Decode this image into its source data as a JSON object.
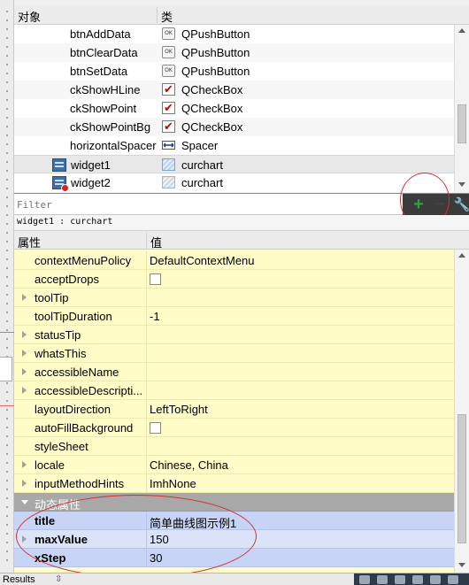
{
  "object_inspector": {
    "col_object": "对象",
    "col_class": "类",
    "rows": [
      {
        "name": "btnAddData",
        "class": "QPushButton",
        "icon": "pushbutton-icon",
        "glyph": "OK"
      },
      {
        "name": "btnClearData",
        "class": "QPushButton",
        "icon": "pushbutton-icon",
        "glyph": "OK"
      },
      {
        "name": "btnSetData",
        "class": "QPushButton",
        "icon": "pushbutton-icon",
        "glyph": "OK"
      },
      {
        "name": "ckShowHLine",
        "class": "QCheckBox",
        "icon": "checkbox-icon",
        "glyph": "✔"
      },
      {
        "name": "ckShowPoint",
        "class": "QCheckBox",
        "icon": "checkbox-icon",
        "glyph": "✔"
      },
      {
        "name": "ckShowPointBg",
        "class": "QCheckBox",
        "icon": "checkbox-icon",
        "glyph": "✔"
      },
      {
        "name": "horizontalSpacer",
        "class": "Spacer",
        "icon": "spacer-icon",
        "glyph": "⟷"
      },
      {
        "name": "widget1",
        "class": "curchart",
        "icon": "curchart-icon",
        "glyph": ""
      },
      {
        "name": "widget2",
        "class": "curchart",
        "icon": "curchart-icon",
        "glyph": ""
      }
    ]
  },
  "filter": {
    "placeholder": "Filter",
    "add_label": "+",
    "remove_label": "−",
    "configure_label": "🔧"
  },
  "selected_caption": "widget1 : curchart",
  "property_editor": {
    "col_property": "属性",
    "col_value": "值",
    "rows": [
      {
        "name": "contextMenuPolicy",
        "value": "DefaultContextMenu"
      },
      {
        "name": "acceptDrops",
        "value": "",
        "checkbox": true
      },
      {
        "name": "toolTip",
        "value": "",
        "expandable": true
      },
      {
        "name": "toolTipDuration",
        "value": "-1"
      },
      {
        "name": "statusTip",
        "value": "",
        "expandable": true
      },
      {
        "name": "whatsThis",
        "value": "",
        "expandable": true
      },
      {
        "name": "accessibleName",
        "value": "",
        "expandable": true
      },
      {
        "name": "accessibleDescripti...",
        "value": "",
        "expandable": true
      },
      {
        "name": "layoutDirection",
        "value": "LeftToRight"
      },
      {
        "name": "autoFillBackground",
        "value": "",
        "checkbox": true
      },
      {
        "name": "styleSheet",
        "value": ""
      },
      {
        "name": "locale",
        "value": "Chinese, China",
        "expandable": true
      },
      {
        "name": "inputMethodHints",
        "value": "ImhNone",
        "expandable": true
      }
    ],
    "group_label": "动态属性",
    "dynamic_rows": [
      {
        "name": "title",
        "value": "简单曲线图示例1",
        "expandable": false
      },
      {
        "name": "maxValue",
        "value": "150",
        "expandable": true
      },
      {
        "name": "xStep",
        "value": "30",
        "expandable": false
      }
    ]
  },
  "statusbar": {
    "results_label": "Results",
    "sort_glyph": "⇳"
  },
  "colors": {
    "property_bg": "#fffcc8",
    "dynamic_bg": "#c7d4f5",
    "group_bg": "#a8a8a8",
    "annotation_red": "#d03030",
    "add_green": "#2ba33a"
  }
}
